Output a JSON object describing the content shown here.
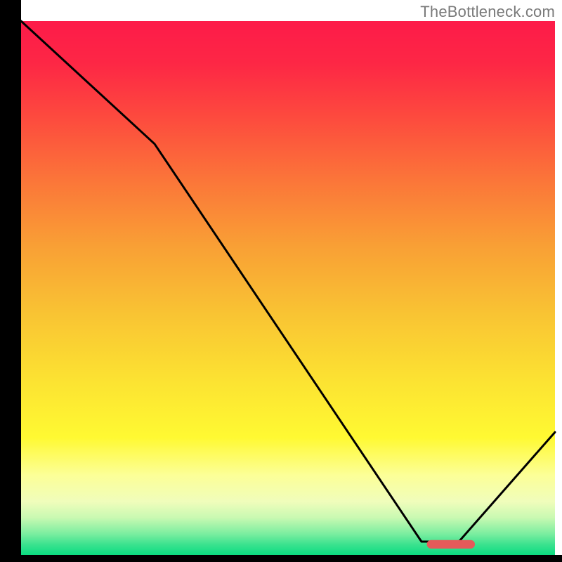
{
  "attribution": "TheBottleneck.com",
  "chart_data": {
    "type": "line",
    "title": "",
    "xlabel": "",
    "ylabel": "",
    "xlim": [
      0,
      100
    ],
    "ylim": [
      0,
      100
    ],
    "grid": false,
    "legend": false,
    "background_gradient": {
      "stops": [
        {
          "offset": 0.0,
          "color": "#fd1b49"
        },
        {
          "offset": 0.08,
          "color": "#fd2745"
        },
        {
          "offset": 0.18,
          "color": "#fd4a3e"
        },
        {
          "offset": 0.3,
          "color": "#fb7639"
        },
        {
          "offset": 0.42,
          "color": "#f99f35"
        },
        {
          "offset": 0.55,
          "color": "#f9c433"
        },
        {
          "offset": 0.68,
          "color": "#fce432"
        },
        {
          "offset": 0.78,
          "color": "#fff932"
        },
        {
          "offset": 0.85,
          "color": "#fcff97"
        },
        {
          "offset": 0.9,
          "color": "#f0fdbb"
        },
        {
          "offset": 0.93,
          "color": "#c9f9b2"
        },
        {
          "offset": 0.96,
          "color": "#7ceea0"
        },
        {
          "offset": 0.98,
          "color": "#3ce28f"
        },
        {
          "offset": 1.0,
          "color": "#0adc81"
        }
      ]
    },
    "series": [
      {
        "name": "bottleneck-curve",
        "type": "line",
        "color": "#000000",
        "x": [
          0,
          25,
          75,
          82,
          100
        ],
        "values": [
          100,
          77,
          2.5,
          2.5,
          23
        ]
      }
    ],
    "marker": {
      "name": "optimal-range",
      "color": "#e55a5a",
      "x_start": 76,
      "x_end": 85,
      "y": 2.0,
      "thickness_pct": 1.6
    },
    "axes_visible": false
  }
}
